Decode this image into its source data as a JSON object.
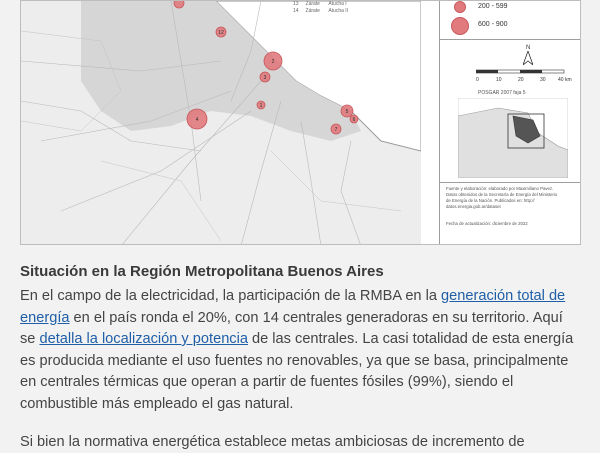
{
  "legend": {
    "table_rows": [
      {
        "n": "13",
        "name": "Zárate",
        "type": "Atucha I"
      },
      {
        "n": "14",
        "name": "Zárate",
        "type": "Atucha II"
      }
    ],
    "ranges": [
      "200 - 599",
      "600 - 900"
    ],
    "north": "N",
    "scale_labels": [
      "0",
      "10",
      "20",
      "30",
      "40 km"
    ],
    "source_caption": "POSGAR 2007 faja 5"
  },
  "map_labels": [
    "12",
    "2",
    "3",
    "1",
    "4",
    "5",
    "6",
    "7"
  ],
  "credits": {
    "lines": [
      "Fuente y elaboración: elaborado por Maximiliano Pavez.",
      "Datos obtenidos de la Secretaría de Energía del Ministerio",
      "de Energía de la Nación. Publicados en: http://",
      "datos.energia.gob.ar/dataset"
    ],
    "date": "Fecha de actualización: diciembre de 2022"
  },
  "article": {
    "heading": "Situación en la Región Metropolitana Buenos Aires",
    "p1_a": "En el campo de la electricidad, la participación de la RMBA en la ",
    "link1": "generación total de energía",
    "p1_b": " en el país ronda el 20%, con 14 centrales generadoras en su territorio. Aquí se ",
    "link2": "detalla la localización y potencia",
    "p1_c": " de las centrales. La casi totalidad de esta energía es producida mediante el uso fuentes no renovables, ya que se basa, principalmente en centrales térmicas que operan a partir de fuentes fósiles (99%), siendo el combustible más empleado el gas natural.",
    "cut_line": "Si bien la normativa energética establece metas ambiciosas de incremento de"
  }
}
